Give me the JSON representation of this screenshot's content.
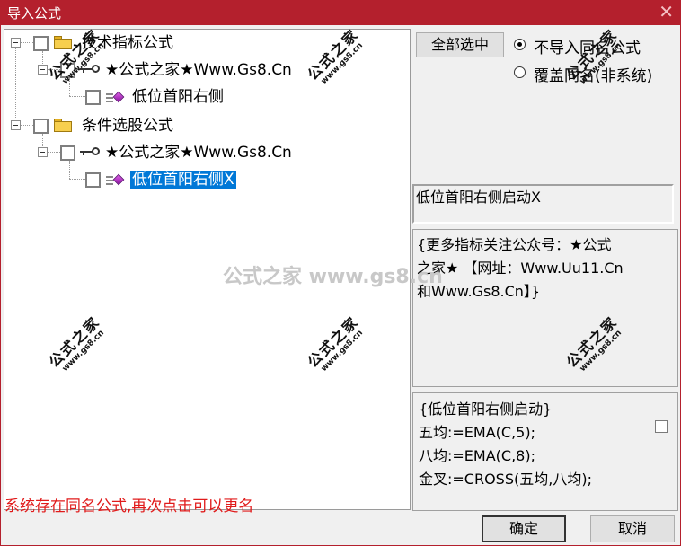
{
  "window": {
    "title": "导入公式",
    "close_glyph": "✕"
  },
  "tree": {
    "nodes": [
      {
        "label": "技术指标公式"
      },
      {
        "label": "★公式之家★Www.Gs8.Cn"
      },
      {
        "label": "低位首阳右侧"
      },
      {
        "label": "条件选股公式"
      },
      {
        "label": "★公式之家★Www.Gs8.Cn"
      },
      {
        "label": "低位首阳右侧X"
      }
    ]
  },
  "options": {
    "select_all_label": "全部选中",
    "radio_skip_label": "不导入同名公式",
    "radio_overwrite_label": "覆盖同名(非系统)",
    "selected_radio": "skip"
  },
  "info": {
    "name_text": "低位首阳右侧启动X",
    "description_lines": [
      "{更多指标关注公众号：★公式",
      "之家★ 【网址：Www.Uu11.Cn",
      "和Www.Gs8.Cn】}"
    ],
    "code_lines": [
      "{低位首阳右侧启动}",
      "五均:=EMA(C,5);",
      "八均:=EMA(C,8);",
      "金叉:=CROSS(五均,八均);"
    ]
  },
  "footer": {
    "status_text": "系统存在同名公式,再次点击可以更名",
    "ok_label": "确定",
    "cancel_label": "取消"
  },
  "watermark": {
    "brand": "公式之家",
    "url": "www.gs8.cn",
    "center_text": "公式之家 www.gs8.cn"
  },
  "colors": {
    "titlebar": "#b4202d",
    "selection": "#0078d7",
    "status_text": "#e01b1b"
  }
}
